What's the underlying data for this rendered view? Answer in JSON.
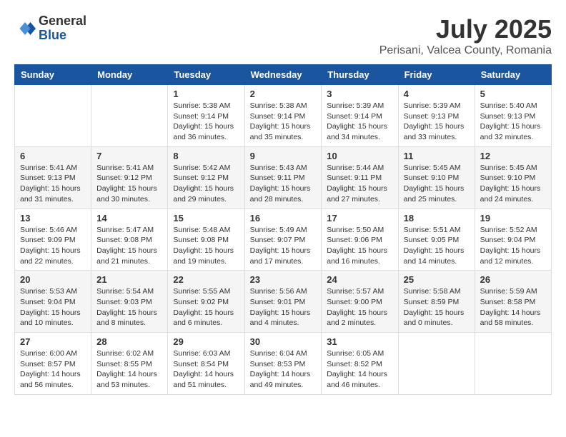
{
  "logo": {
    "general": "General",
    "blue": "Blue"
  },
  "title": "July 2025",
  "location": "Perisani, Valcea County, Romania",
  "days_of_week": [
    "Sunday",
    "Monday",
    "Tuesday",
    "Wednesday",
    "Thursday",
    "Friday",
    "Saturday"
  ],
  "weeks": [
    [
      {
        "day": "",
        "info": ""
      },
      {
        "day": "",
        "info": ""
      },
      {
        "day": "1",
        "info": "Sunrise: 5:38 AM\nSunset: 9:14 PM\nDaylight: 15 hours and 36 minutes."
      },
      {
        "day": "2",
        "info": "Sunrise: 5:38 AM\nSunset: 9:14 PM\nDaylight: 15 hours and 35 minutes."
      },
      {
        "day": "3",
        "info": "Sunrise: 5:39 AM\nSunset: 9:14 PM\nDaylight: 15 hours and 34 minutes."
      },
      {
        "day": "4",
        "info": "Sunrise: 5:39 AM\nSunset: 9:13 PM\nDaylight: 15 hours and 33 minutes."
      },
      {
        "day": "5",
        "info": "Sunrise: 5:40 AM\nSunset: 9:13 PM\nDaylight: 15 hours and 32 minutes."
      }
    ],
    [
      {
        "day": "6",
        "info": "Sunrise: 5:41 AM\nSunset: 9:13 PM\nDaylight: 15 hours and 31 minutes."
      },
      {
        "day": "7",
        "info": "Sunrise: 5:41 AM\nSunset: 9:12 PM\nDaylight: 15 hours and 30 minutes."
      },
      {
        "day": "8",
        "info": "Sunrise: 5:42 AM\nSunset: 9:12 PM\nDaylight: 15 hours and 29 minutes."
      },
      {
        "day": "9",
        "info": "Sunrise: 5:43 AM\nSunset: 9:11 PM\nDaylight: 15 hours and 28 minutes."
      },
      {
        "day": "10",
        "info": "Sunrise: 5:44 AM\nSunset: 9:11 PM\nDaylight: 15 hours and 27 minutes."
      },
      {
        "day": "11",
        "info": "Sunrise: 5:45 AM\nSunset: 9:10 PM\nDaylight: 15 hours and 25 minutes."
      },
      {
        "day": "12",
        "info": "Sunrise: 5:45 AM\nSunset: 9:10 PM\nDaylight: 15 hours and 24 minutes."
      }
    ],
    [
      {
        "day": "13",
        "info": "Sunrise: 5:46 AM\nSunset: 9:09 PM\nDaylight: 15 hours and 22 minutes."
      },
      {
        "day": "14",
        "info": "Sunrise: 5:47 AM\nSunset: 9:08 PM\nDaylight: 15 hours and 21 minutes."
      },
      {
        "day": "15",
        "info": "Sunrise: 5:48 AM\nSunset: 9:08 PM\nDaylight: 15 hours and 19 minutes."
      },
      {
        "day": "16",
        "info": "Sunrise: 5:49 AM\nSunset: 9:07 PM\nDaylight: 15 hours and 17 minutes."
      },
      {
        "day": "17",
        "info": "Sunrise: 5:50 AM\nSunset: 9:06 PM\nDaylight: 15 hours and 16 minutes."
      },
      {
        "day": "18",
        "info": "Sunrise: 5:51 AM\nSunset: 9:05 PM\nDaylight: 15 hours and 14 minutes."
      },
      {
        "day": "19",
        "info": "Sunrise: 5:52 AM\nSunset: 9:04 PM\nDaylight: 15 hours and 12 minutes."
      }
    ],
    [
      {
        "day": "20",
        "info": "Sunrise: 5:53 AM\nSunset: 9:04 PM\nDaylight: 15 hours and 10 minutes."
      },
      {
        "day": "21",
        "info": "Sunrise: 5:54 AM\nSunset: 9:03 PM\nDaylight: 15 hours and 8 minutes."
      },
      {
        "day": "22",
        "info": "Sunrise: 5:55 AM\nSunset: 9:02 PM\nDaylight: 15 hours and 6 minutes."
      },
      {
        "day": "23",
        "info": "Sunrise: 5:56 AM\nSunset: 9:01 PM\nDaylight: 15 hours and 4 minutes."
      },
      {
        "day": "24",
        "info": "Sunrise: 5:57 AM\nSunset: 9:00 PM\nDaylight: 15 hours and 2 minutes."
      },
      {
        "day": "25",
        "info": "Sunrise: 5:58 AM\nSunset: 8:59 PM\nDaylight: 15 hours and 0 minutes."
      },
      {
        "day": "26",
        "info": "Sunrise: 5:59 AM\nSunset: 8:58 PM\nDaylight: 14 hours and 58 minutes."
      }
    ],
    [
      {
        "day": "27",
        "info": "Sunrise: 6:00 AM\nSunset: 8:57 PM\nDaylight: 14 hours and 56 minutes."
      },
      {
        "day": "28",
        "info": "Sunrise: 6:02 AM\nSunset: 8:55 PM\nDaylight: 14 hours and 53 minutes."
      },
      {
        "day": "29",
        "info": "Sunrise: 6:03 AM\nSunset: 8:54 PM\nDaylight: 14 hours and 51 minutes."
      },
      {
        "day": "30",
        "info": "Sunrise: 6:04 AM\nSunset: 8:53 PM\nDaylight: 14 hours and 49 minutes."
      },
      {
        "day": "31",
        "info": "Sunrise: 6:05 AM\nSunset: 8:52 PM\nDaylight: 14 hours and 46 minutes."
      },
      {
        "day": "",
        "info": ""
      },
      {
        "day": "",
        "info": ""
      }
    ]
  ]
}
